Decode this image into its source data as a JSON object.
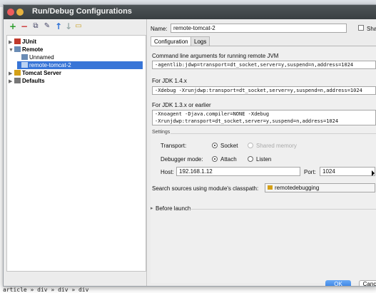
{
  "window": {
    "title": "Run/Debug Configurations"
  },
  "toolbar": {
    "add": "+",
    "remove": "−",
    "copy": "⧉",
    "edit": "✎",
    "up": "↑",
    "down": "↓",
    "folder": "▭"
  },
  "tree": {
    "items": [
      {
        "label": "JUnit",
        "bold": true
      },
      {
        "label": "Remote",
        "bold": true
      },
      {
        "label": "Unnamed",
        "bold": false
      },
      {
        "label": "remote-tomcat-2",
        "bold": false
      },
      {
        "label": "Tomcat Server",
        "bold": true
      },
      {
        "label": "Defaults",
        "bold": true
      }
    ]
  },
  "form": {
    "name_label": "Name:",
    "name_value": "remote-tomcat-2",
    "share_label": "Sha",
    "tabs": [
      "Configuration",
      "Logs"
    ],
    "cmd_label": "Command line arguments for running remote JVM",
    "cmd_value": "-agentlib:jdwp=transport=dt_socket,server=y,suspend=n,address=1024",
    "jdk14_label": "For JDK 1.4.x",
    "jdk14_value": "-Xdebug -Xrunjdwp:transport=dt_socket,server=y,suspend=n,address=1024",
    "jdk13_label": "For JDK 1.3.x or earlier",
    "jdk13_line1": "-Xnoagent -Djava.compiler=NONE -Xdebug",
    "jdk13_line2": "-Xrunjdwp:transport=dt_socket,server=y,suspend=n,address=1024",
    "settings_label": "Settings",
    "transport_label": "Transport:",
    "transport_socket": "Socket",
    "transport_shmem": "Shared memory",
    "debugger_label": "Debugger mode:",
    "debugger_attach": "Attach",
    "debugger_listen": "Listen",
    "host_label": "Host:",
    "host_value": "192.168.1.12",
    "port_label": "Port:",
    "port_value": "1024",
    "classpath_label": "Search sources using module's classpath:",
    "classpath_value": "remotedebugging",
    "before_launch_label": "Before launch"
  },
  "buttons": {
    "ok": "OK",
    "cancel": "Canc"
  },
  "breadcrumb": "article » div » div » div",
  "colors": {
    "selection": "#3875d7",
    "ok_button": "#2f7be0"
  }
}
